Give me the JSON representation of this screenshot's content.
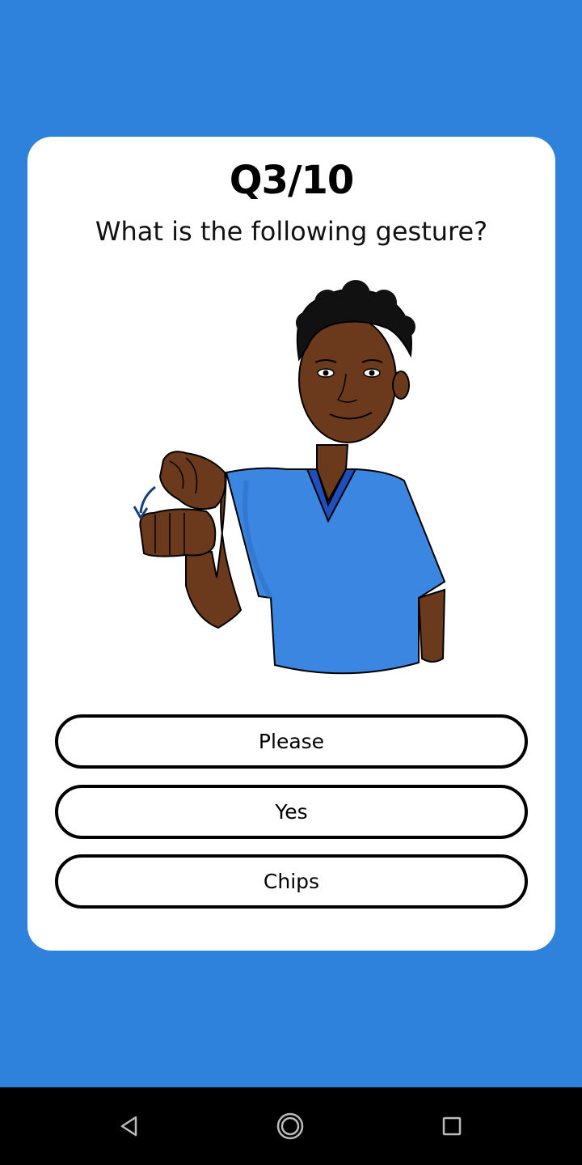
{
  "quiz": {
    "progress": "Q3/10",
    "question": "What is the following gesture?",
    "illustration": "person-signing-gesture",
    "answers": [
      {
        "label": "Please"
      },
      {
        "label": "Yes"
      },
      {
        "label": "Chips"
      }
    ]
  },
  "colors": {
    "background": "#2f82dc",
    "card": "#ffffff",
    "shirt": "#3a86e0",
    "skin": "#6b3a1c"
  },
  "nav": {
    "icons": [
      "back-icon",
      "home-icon",
      "recent-apps-icon"
    ]
  }
}
